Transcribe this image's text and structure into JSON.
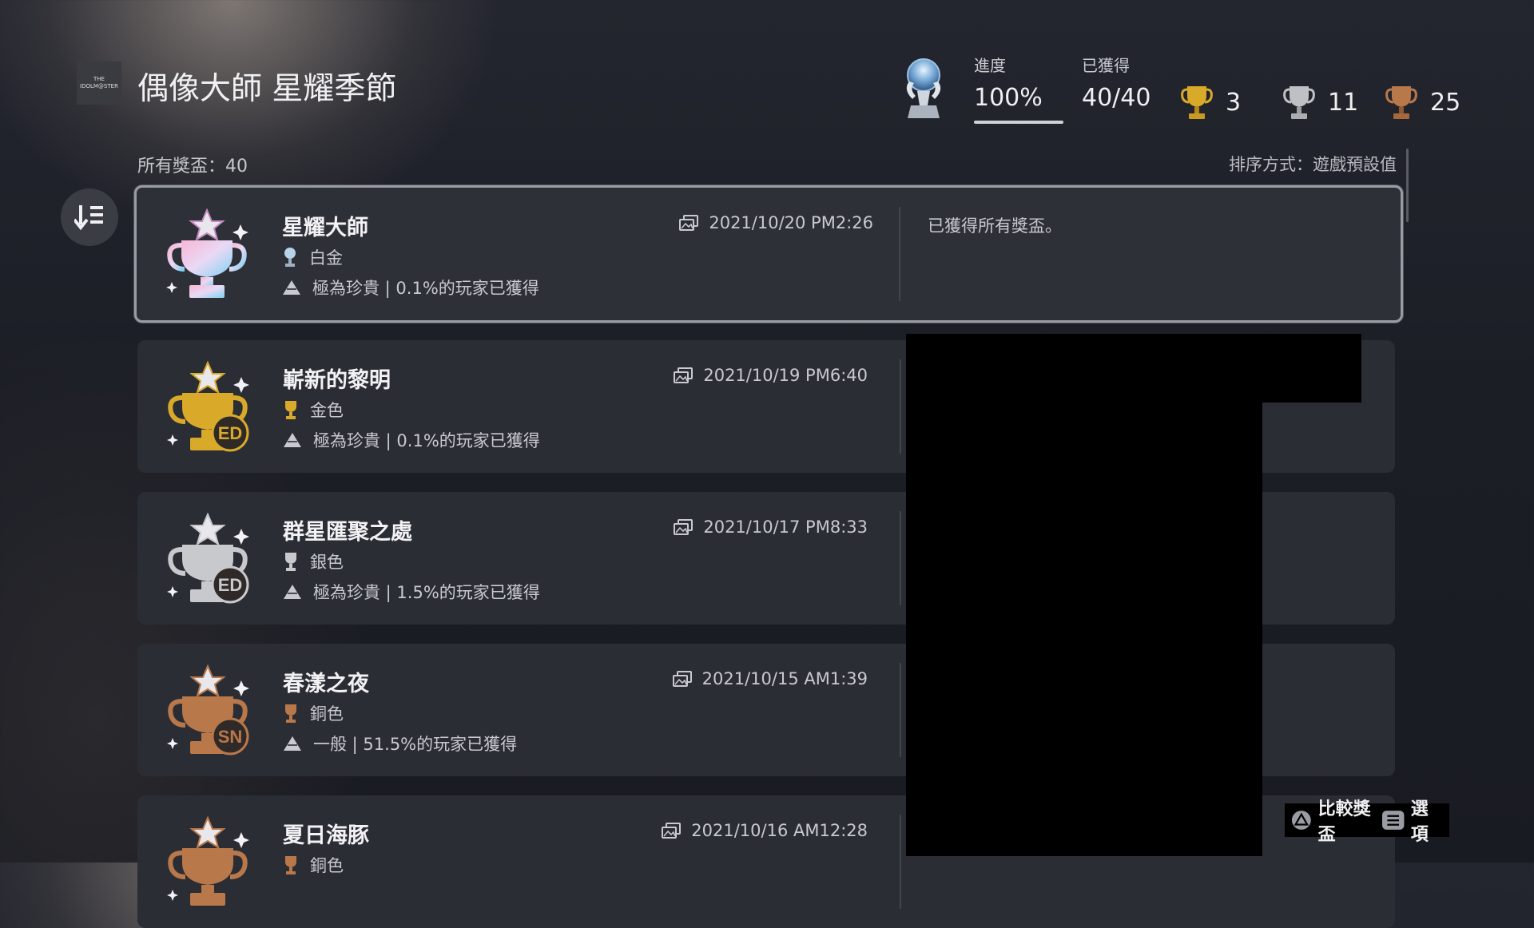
{
  "header": {
    "logo_text": "THE IDOLM@STER",
    "game_title": "偶像大師 星耀季節",
    "progress_label": "進度",
    "progress_value": "100%",
    "earned_label": "已獲得",
    "earned_value": "40/40",
    "gold_count": "3",
    "silver_count": "11",
    "bronze_count": "25"
  },
  "list": {
    "total_label": "所有獎盃：40",
    "sort_label": "排序方式：遊戲預設值"
  },
  "trophies": [
    {
      "name": "星耀大師",
      "grade": "白金",
      "rarity": "極為珍貴 | 0.1%的玩家已獲得",
      "date": "2021/10/20  PM2:26",
      "desc": "已獲得所有獎盃。",
      "badge": "",
      "tier": "platinum"
    },
    {
      "name": "嶄新的黎明",
      "grade": "金色",
      "rarity": "極為珍貴 | 0.1%的玩家已獲得",
      "date": "2021/10/19  PM6:40",
      "badge": "ED",
      "tier": "gold"
    },
    {
      "name": "群星匯聚之處",
      "grade": "銀色",
      "rarity": "極為珍貴 | 1.5%的玩家已獲得",
      "date": "2021/10/17  PM8:33",
      "badge": "ED",
      "tier": "silver"
    },
    {
      "name": "春漾之夜",
      "grade": "銅色",
      "rarity": "一般 | 51.5%的玩家已獲得",
      "date": "2021/10/15  AM1:39",
      "badge": "SN",
      "tier": "bronze"
    },
    {
      "name": "夏日海豚",
      "grade": "銅色",
      "rarity": "",
      "date": "2021/10/16  AM12:28",
      "badge": "",
      "tier": "bronze"
    }
  ],
  "footer": {
    "compare_label": "比較獎盃",
    "options_label": "選項"
  },
  "colors": {
    "platinum": "#b7d4ea",
    "gold": "#d9a92a",
    "silver": "#c8c9cc",
    "bronze": "#b9784a"
  }
}
